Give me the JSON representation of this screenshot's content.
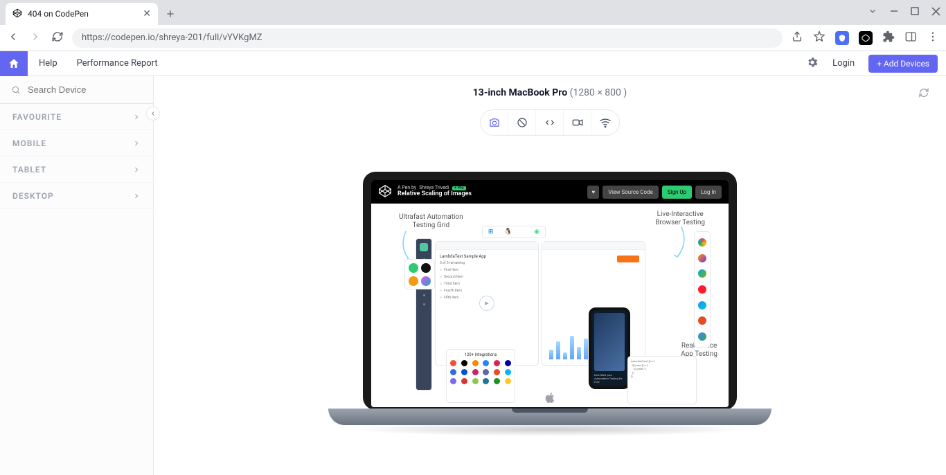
{
  "browser": {
    "tab_title": "404 on CodePen",
    "url_display": "https://codepen.io/shreya-201/full/vYVKgMZ"
  },
  "app_header": {
    "menu": {
      "help": "Help",
      "perf": "Performance Report"
    },
    "login": "Login",
    "add_devices": "+ Add Devices"
  },
  "sidebar": {
    "search_placeholder": "Search Device",
    "items": [
      "FAVOURITE",
      "MOBILE",
      "TABLET",
      "DESKTOP"
    ]
  },
  "device": {
    "name": "13-inch MacBook Pro",
    "dims": "(1280 × 800 )"
  },
  "pen": {
    "author_prefix": "A Pen by",
    "author": "Shreya Trivedi",
    "pro_badge": "+ Pro",
    "title": "Relative Scaling of Images",
    "view_source": "View Source Code",
    "signup": "Sign Up",
    "login": "Log In"
  },
  "callouts": {
    "c1": "Ultrafast Automation\nTesting Grid",
    "c2": "Live-Interactive\nBrowser Testing",
    "c3": "Real Device\nApp Testing",
    "integrations": "120+ Integrations",
    "sample_app": "LambdaTest Sample App",
    "sample_sub": "5 of 5 remaining",
    "sample_rows": [
      "First Item",
      "Second Item",
      "Third Item",
      "Fourth Item",
      "Fifth Item"
    ],
    "phone_text": "Kick Start your Automation Testing for Free"
  }
}
